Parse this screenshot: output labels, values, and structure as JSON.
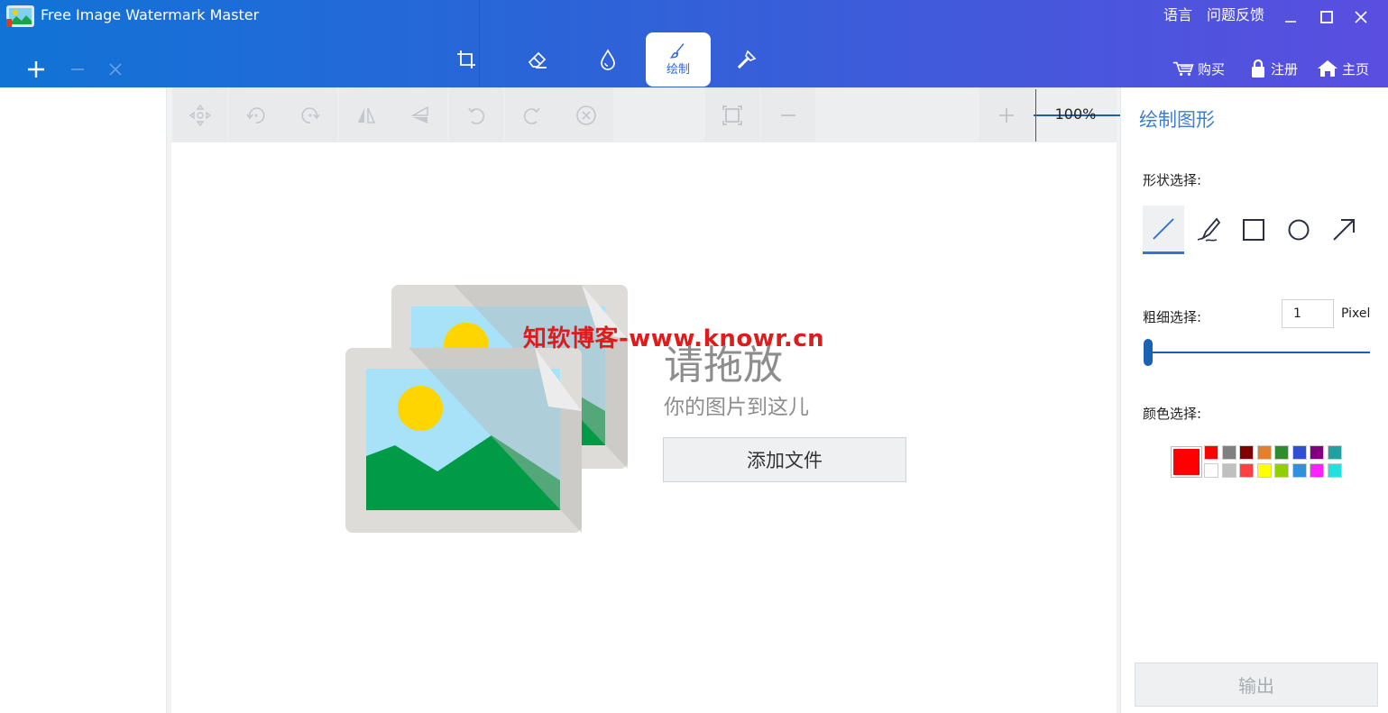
{
  "window": {
    "title": "Free Image Watermark Master",
    "language_label": "语言",
    "feedback_label": "问题反馈",
    "minimize_icon": "minimize-icon",
    "maximize_icon": "maximize-icon",
    "close_icon": "close-icon"
  },
  "file_actions": {
    "add_icon": "plus-icon",
    "remove_icon": "minus-icon",
    "clear_icon": "x-icon"
  },
  "tool_tabs": [
    {
      "icon": "crop-icon",
      "label": ""
    },
    {
      "icon": "eraser-icon",
      "label": ""
    },
    {
      "icon": "water-drop-icon",
      "label": ""
    },
    {
      "icon": "brush-icon",
      "label": "绘制",
      "active": true
    },
    {
      "icon": "magic-wand-icon",
      "label": ""
    }
  ],
  "nav": {
    "buy_label": "购买",
    "register_label": "注册",
    "home_label": "主页"
  },
  "toolbar": {
    "buttons": [
      "move-icon",
      "rotate-left-icon",
      "rotate-right-icon",
      "flip-horizontal-icon",
      "flip-vertical-icon",
      "undo-icon",
      "redo-icon",
      "clear-icon"
    ],
    "fit_icon": "fit-screen-icon",
    "zoom_out_icon": "minus-icon",
    "zoom_in_icon": "plus-icon",
    "zoom_value": 0.1,
    "zoom_level": "100%"
  },
  "canvas": {
    "watermark": "知软博客-www.knowr.cn",
    "drop_title": "请拖放",
    "drop_subtitle": "你的图片到这儿",
    "add_file_label": "添加文件"
  },
  "panel": {
    "title": "绘制图形",
    "shape_label": "形状选择:",
    "shapes": [
      "line-icon",
      "pen-icon",
      "rectangle-icon",
      "circle-icon",
      "arrow-icon"
    ],
    "active_shape": "line-icon",
    "thickness_label": "粗细选择:",
    "thickness_value": "1",
    "thickness_unit": "Pixel",
    "color_label": "颜色选择:",
    "current_color": "#ff0000",
    "palette": [
      "#ff0000",
      "#808080",
      "#800000",
      "#e08030",
      "#2e8b2e",
      "#3050d0",
      "#800080",
      "#20a0a0",
      "#ffffff",
      "#c0c0c0",
      "#ff4040",
      "#ffff00",
      "#90d000",
      "#3090e0",
      "#ff20ff",
      "#20e0e0"
    ],
    "export_label": "输出"
  }
}
